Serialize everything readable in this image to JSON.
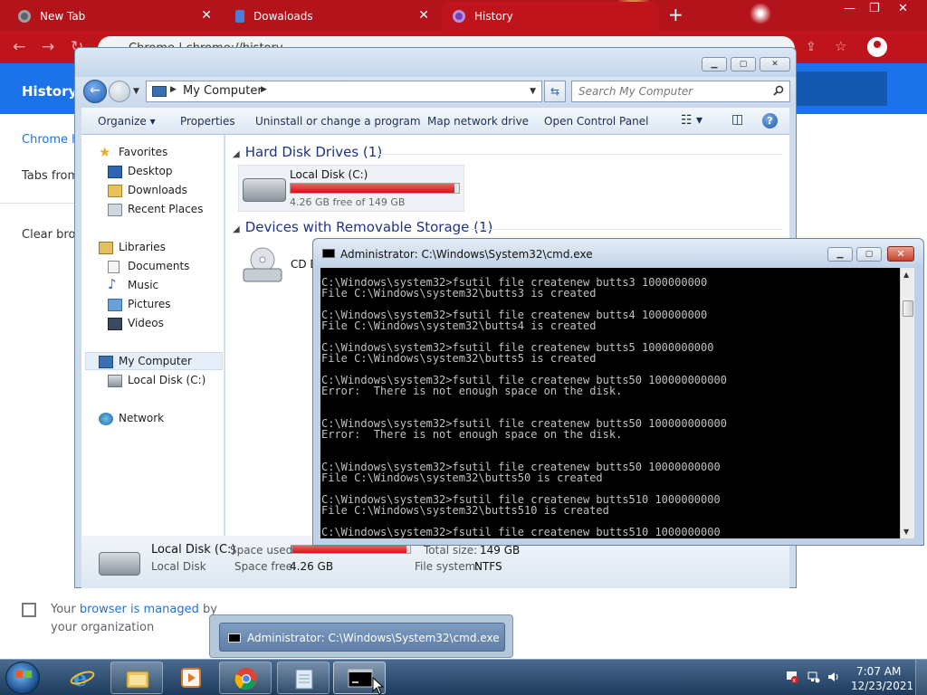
{
  "browser": {
    "tabs": [
      {
        "label": "New Tab"
      },
      {
        "label": "Dowaloads"
      },
      {
        "label": "History"
      }
    ],
    "omnibox_text": "Chrome  |  chrome://history",
    "history_title": "History",
    "sidebar": {
      "chrome_history": "Chrome h",
      "tabs_from": "Tabs from",
      "clear_browsing": "Clear brow"
    },
    "managed": {
      "prefix": "Your ",
      "link": "browser is managed",
      "suffix": " by",
      "line2": "your organization"
    }
  },
  "explorer": {
    "breadcrumb": "My Computer",
    "search_placeholder": "Search My Computer",
    "commands": {
      "organize": "Organize",
      "properties": "Properties",
      "uninstall": "Uninstall or change a program",
      "map_drive": "Map network drive",
      "control_panel": "Open Control Panel"
    },
    "nav": {
      "favorites": "Favorites",
      "desktop": "Desktop",
      "downloads": "Downloads",
      "recent_places": "Recent Places",
      "libraries": "Libraries",
      "documents": "Documents",
      "music": "Music",
      "pictures": "Pictures",
      "videos": "Videos",
      "my_computer": "My Computer",
      "local_disk": "Local Disk (C:)",
      "network": "Network"
    },
    "groups": {
      "hard_disks": "Hard Disk Drives (1)",
      "removable": "Devices with Removable Storage (1)"
    },
    "drive": {
      "name": "Local Disk (C:)",
      "free_text": "4.26 GB free of 149 GB",
      "used_fraction": 0.971
    },
    "cd_label": "CD D",
    "details": {
      "name": "Local Disk (C:)",
      "type": "Local Disk",
      "space_used_label": "Space used:",
      "space_free_label": "Space free:",
      "space_free_value": "4.26 GB",
      "total_size_label": "Total size:",
      "total_size_value": "149 GB",
      "file_system_label": "File system:",
      "file_system_value": "NTFS"
    }
  },
  "cmd": {
    "title": "Administrator: C:\\Windows\\System32\\cmd.exe",
    "output": "C:\\Windows\\system32>fsutil file createnew butts3 1000000000\nFile C:\\Windows\\system32\\butts3 is created\n\nC:\\Windows\\system32>fsutil file createnew butts4 1000000000\nFile C:\\Windows\\system32\\butts4 is created\n\nC:\\Windows\\system32>fsutil file createnew butts5 10000000000\nFile C:\\Windows\\system32\\butts5 is created\n\nC:\\Windows\\system32>fsutil file createnew butts50 100000000000\nError:  There is not enough space on the disk.\n\n\nC:\\Windows\\system32>fsutil file createnew butts50 100000000000\nError:  There is not enough space on the disk.\n\n\nC:\\Windows\\system32>fsutil file createnew butts50 10000000000\nFile C:\\Windows\\system32\\butts50 is created\n\nC:\\Windows\\system32>fsutil file createnew butts510 1000000000\nFile C:\\Windows\\system32\\butts510 is created\n\nC:\\Windows\\system32>fsutil file createnew butts510 1000000000"
  },
  "taskbar": {
    "thumbnail_title": "Administrator: C:\\Windows\\System32\\cmd.exe",
    "clock_time": "7:07 AM",
    "clock_date": "12/23/2021"
  },
  "colors": {
    "chrome_theme": "#c0141d",
    "history_header": "#1a73e8",
    "usage_bar": "#d2121a"
  }
}
